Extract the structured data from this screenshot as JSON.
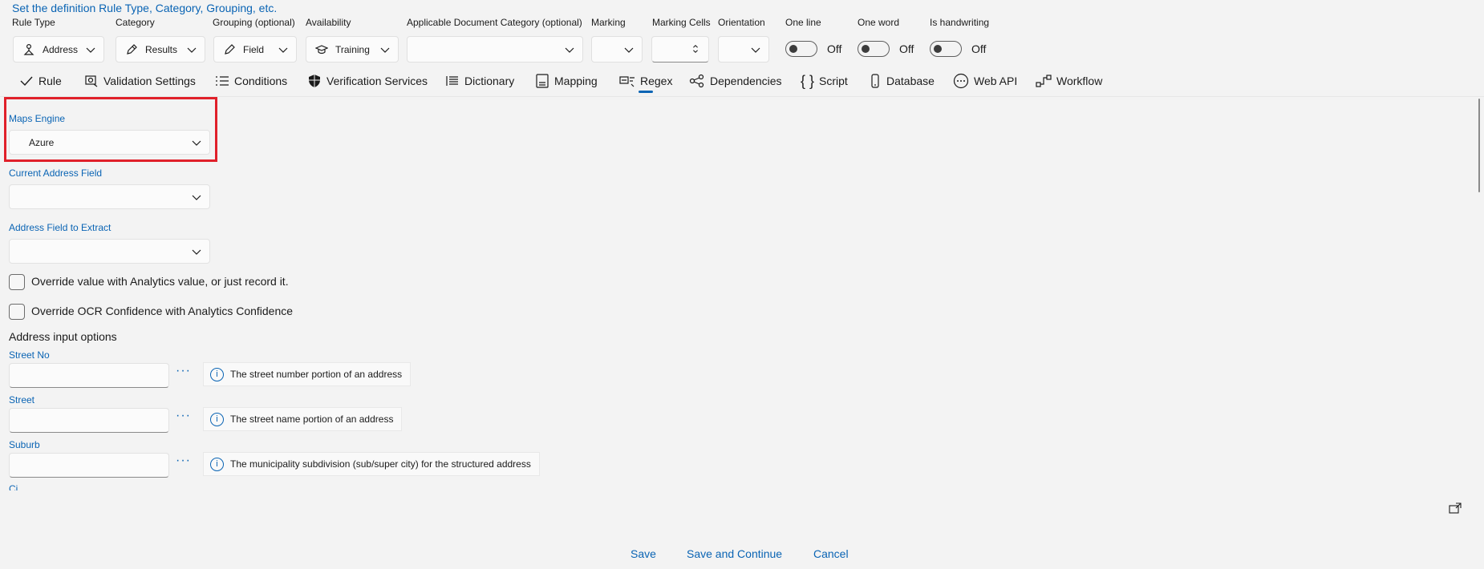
{
  "header": {
    "title": "Set the definition Rule Type, Category, Grouping, etc."
  },
  "fields": {
    "rule_type": {
      "label": "Rule Type",
      "value": "Address",
      "icon": "address-icon"
    },
    "category": {
      "label": "Category",
      "value": "Results",
      "icon": "pen-icon"
    },
    "grouping": {
      "label": "Grouping (optional)",
      "value": "Field",
      "icon": "pencil-icon"
    },
    "availability": {
      "label": "Availability",
      "value": "Training",
      "icon": "graduation-cap-icon"
    },
    "doc_category": {
      "label": "Applicable Document Category (optional)",
      "value": ""
    },
    "marking": {
      "label": "Marking",
      "value": ""
    },
    "marking_cells": {
      "label": "Marking Cells",
      "value": ""
    },
    "orientation": {
      "label": "Orientation",
      "value": ""
    },
    "one_line": {
      "label": "One line",
      "state": "Off"
    },
    "one_word": {
      "label": "One word",
      "state": "Off"
    },
    "is_handwriting": {
      "label": "Is handwriting",
      "state": "Off"
    }
  },
  "tabs": [
    {
      "label": "Rule",
      "icon": "checkmark-icon"
    },
    {
      "label": "Validation Settings",
      "icon": "validation-settings-icon"
    },
    {
      "label": "Conditions",
      "icon": "conditions-list-icon"
    },
    {
      "label": "Verification Services",
      "icon": "shield-icon"
    },
    {
      "label": "Dictionary",
      "icon": "dictionary-list-icon"
    },
    {
      "label": "Mapping",
      "icon": "mapping-icon"
    },
    {
      "label": "Regex",
      "icon": "regex-icon",
      "selected": true
    },
    {
      "label": "Dependencies",
      "icon": "dependencies-icon"
    },
    {
      "label": "Script",
      "icon": "braces-icon"
    },
    {
      "label": "Database",
      "icon": "database-icon"
    },
    {
      "label": "Web API",
      "icon": "web-api-icon"
    },
    {
      "label": "Workflow",
      "icon": "workflow-icon"
    }
  ],
  "form": {
    "maps_engine": {
      "label": "Maps Engine",
      "value": "Azure"
    },
    "current_address_field": {
      "label": "Current Address Field",
      "value": ""
    },
    "address_field_to_extract": {
      "label": "Address Field to Extract",
      "value": ""
    },
    "override_value": {
      "label": "Override value with Analytics value, or just record it.",
      "checked": false
    },
    "override_ocr": {
      "label": "Override OCR Confidence with Analytics Confidence",
      "checked": false
    },
    "address_input_options": {
      "heading": "Address input options",
      "items": [
        {
          "label": "Street No",
          "value": "",
          "more": "···",
          "info": "The street number portion of an address"
        },
        {
          "label": "Street",
          "value": "",
          "more": "···",
          "info": "The street name portion of an address"
        },
        {
          "label": "Suburb",
          "value": "",
          "more": "···",
          "info": "The municipality subdivision (sub/super city) for the structured address"
        }
      ],
      "partial_label": "Ci"
    }
  },
  "footer": {
    "save": "Save",
    "save_continue": "Save and Continue",
    "cancel": "Cancel"
  },
  "colors": {
    "accent": "#0a64b4",
    "highlight": "#e0202a",
    "background": "#f3f3f3"
  }
}
